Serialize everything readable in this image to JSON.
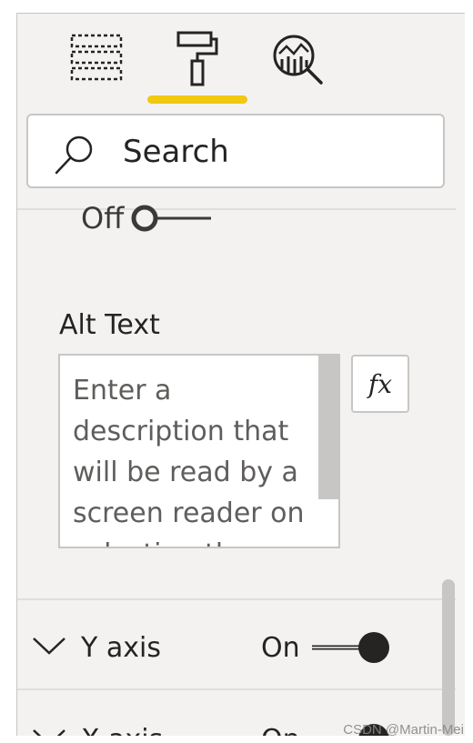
{
  "tabs": [
    {
      "name": "fields",
      "icon": "fields-icon"
    },
    {
      "name": "format",
      "icon": "paint-roller-icon",
      "active": true
    },
    {
      "name": "analytics",
      "icon": "analytics-icon"
    }
  ],
  "colors": {
    "accent": "#f2c811",
    "panel_bg": "#f3f2f1",
    "border": "#c8c6c4",
    "text": "#252423"
  },
  "search": {
    "placeholder": "Search"
  },
  "accessibility": {
    "toggle_label": "Off"
  },
  "alt_text": {
    "label": "Alt Text",
    "placeholder": "Enter a description that will be read by a screen reader on selecting the",
    "fx_label": "fx"
  },
  "cards": [
    {
      "title": "Y axis",
      "state": "On"
    },
    {
      "title": "X axis",
      "state": "On"
    }
  ],
  "watermark": "CSDN @Martin-Mei"
}
